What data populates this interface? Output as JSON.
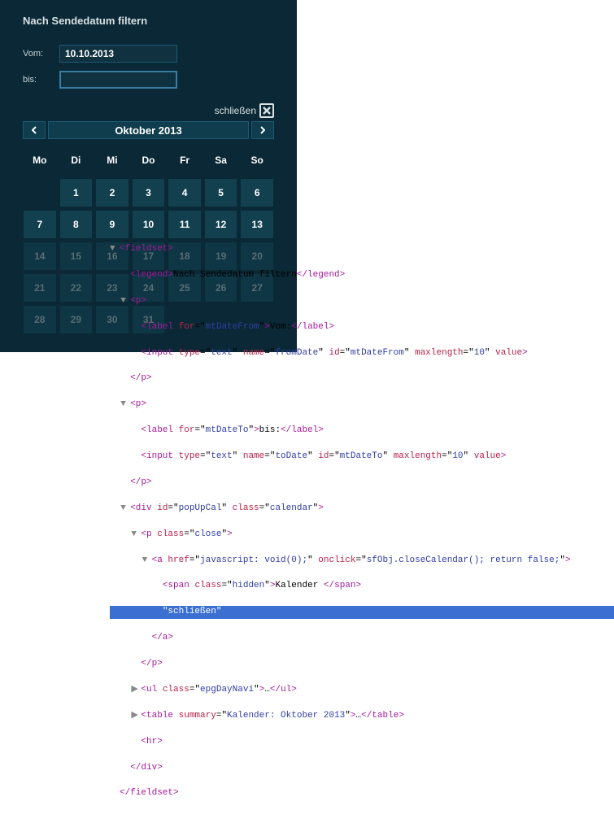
{
  "header": {
    "title": "Nach Sendedatum filtern"
  },
  "fields": {
    "from": {
      "label": "Vom:",
      "value": "10.10.2013"
    },
    "to": {
      "label": "bis:",
      "value": ""
    }
  },
  "calendar": {
    "close_label": "schließen",
    "month_label": "Oktober 2013",
    "day_headers": [
      "Mo",
      "Di",
      "Mi",
      "Do",
      "Fr",
      "Sa",
      "So"
    ],
    "weeks": [
      [
        "",
        "1",
        "2",
        "3",
        "4",
        "5",
        "6"
      ],
      [
        "7",
        "8",
        "9",
        "10",
        "11",
        "12",
        "13"
      ],
      [
        "14",
        "15",
        "16",
        "17",
        "18",
        "19",
        "20"
      ],
      [
        "21",
        "22",
        "23",
        "24",
        "25",
        "26",
        "27"
      ],
      [
        "28",
        "29",
        "30",
        "31",
        "",
        "",
        ""
      ]
    ]
  },
  "code_tree": {
    "lines": [
      {
        "indent": 0,
        "expand": "down",
        "html": "<span class='tag'>&lt;fieldset&gt;</span>"
      },
      {
        "indent": 1,
        "expand": "",
        "html": "<span class='tag'>&lt;legend&gt;</span><span class='txt'>Nach Sendedatum filtern</span><span class='tag'>&lt;/legend&gt;</span>"
      },
      {
        "indent": 1,
        "expand": "down",
        "html": "<span class='tag'>&lt;p&gt;</span>"
      },
      {
        "indent": 2,
        "expand": "",
        "html": "<span class='tag'>&lt;label</span> <span class='attr'>for</span>=\"<span class='val'>mtDateFrom</span>\"<span class='tag'>&gt;</span><span class='txt'>Vom:</span><span class='tag'>&lt;/label&gt;</span>"
      },
      {
        "indent": 2,
        "expand": "",
        "html": "<span class='tag'>&lt;input</span> <span class='attr'>type</span>=\"<span class='val'>text</span>\" <span class='attr'>name</span>=\"<span class='val'>fromDate</span>\" <span class='attr'>id</span>=\"<span class='val'>mtDateFrom</span>\" <span class='attr'>maxlength</span>=\"<span class='val'>10</span>\" <span class='attr'>value</span><span class='tag'>&gt;</span>"
      },
      {
        "indent": 1,
        "expand": "",
        "html": "<span class='tag'>&lt;/p&gt;</span>"
      },
      {
        "indent": 1,
        "expand": "down",
        "html": "<span class='tag'>&lt;p&gt;</span>"
      },
      {
        "indent": 2,
        "expand": "",
        "html": "<span class='tag'>&lt;label</span> <span class='attr'>for</span>=\"<span class='val'>mtDateTo</span>\"<span class='tag'>&gt;</span><span class='txt'>bis:</span><span class='tag'>&lt;/label&gt;</span>"
      },
      {
        "indent": 2,
        "expand": "",
        "html": "<span class='tag'>&lt;input</span> <span class='attr'>type</span>=\"<span class='val'>text</span>\" <span class='attr'>name</span>=\"<span class='val'>toDate</span>\" <span class='attr'>id</span>=\"<span class='val'>mtDateTo</span>\" <span class='attr'>maxlength</span>=\"<span class='val'>10</span>\" <span class='attr'>value</span><span class='tag'>&gt;</span>"
      },
      {
        "indent": 1,
        "expand": "",
        "html": "<span class='tag'>&lt;/p&gt;</span>"
      },
      {
        "indent": 1,
        "expand": "down",
        "html": "<span class='tag'>&lt;div</span> <span class='attr'>id</span>=\"<span class='val'>popUpCal</span>\" <span class='attr'>class</span>=\"<span class='val'>calendar</span>\"<span class='tag'>&gt;</span>"
      },
      {
        "indent": 2,
        "expand": "down",
        "html": "<span class='tag'>&lt;p</span> <span class='attr'>class</span>=\"<span class='val'>close</span>\"<span class='tag'>&gt;</span>"
      },
      {
        "indent": 3,
        "expand": "down",
        "html": "<span class='tag'>&lt;a</span> <span class='attr'>href</span>=\"<span class='val'>javascript: void(0);</span>\" <span class='attr'>onclick</span>=\"<span class='val'>sfObj.closeCalendar(); return false;</span>\"<span class='tag'>&gt;</span>"
      },
      {
        "indent": 4,
        "expand": "",
        "html": "<span class='tag'>&lt;span</span> <span class='attr'>class</span>=\"<span class='val'>hidden</span>\"<span class='tag'>&gt;</span><span class='txt'>Kalender </span><span class='tag'>&lt;/span&gt;</span>"
      },
      {
        "indent": 4,
        "expand": "",
        "hl": true,
        "html": "\"<span class='txt'>schließen</span>\""
      },
      {
        "indent": 3,
        "expand": "",
        "html": "<span class='tag'>&lt;/a&gt;</span>"
      },
      {
        "indent": 2,
        "expand": "",
        "html": "<span class='tag'>&lt;/p&gt;</span>"
      },
      {
        "indent": 2,
        "expand": "right",
        "html": "<span class='tag'>&lt;ul</span> <span class='attr'>class</span>=\"<span class='val'>epgDayNavi</span>\"<span class='tag'>&gt;</span><span class='txt'>…</span><span class='tag'>&lt;/ul&gt;</span>"
      },
      {
        "indent": 2,
        "expand": "right",
        "html": "<span class='tag'>&lt;table</span> <span class='attr'>summary</span>=\"<span class='val'>Kalender: Oktober 2013</span>\"<span class='tag'>&gt;</span><span class='txt'>…</span><span class='tag'>&lt;/table&gt;</span>"
      },
      {
        "indent": 2,
        "expand": "",
        "html": "<span class='tag'>&lt;hr&gt;</span>"
      },
      {
        "indent": 1,
        "expand": "",
        "html": "<span class='tag'>&lt;/div&gt;</span>"
      },
      {
        "indent": 0,
        "expand": "",
        "html": "<span class='tag'>&lt;/fieldset&gt;</span>"
      }
    ]
  }
}
